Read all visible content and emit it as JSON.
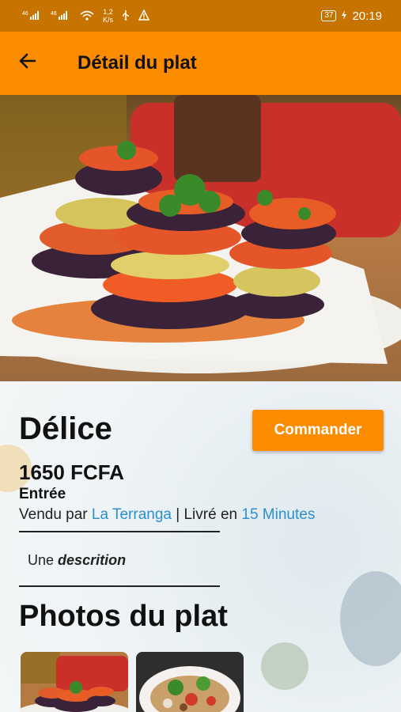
{
  "status_bar": {
    "signal1": "⁴⁶",
    "signal2": "⁴⁶",
    "speed_value": "1,2",
    "speed_unit": "K/s",
    "battery": "37",
    "time": "20:19"
  },
  "app_bar": {
    "title": "Détail du plat"
  },
  "dish": {
    "name": "Délice",
    "order_button": "Commander",
    "price": "1650 FCFA",
    "category": "Entrée",
    "sold_by_prefix": "Vendu par",
    "restaurant": "La Terranga",
    "separator": "|",
    "delivered_prefix": "Livré en",
    "delivery_time": "15 Minutes",
    "description_prefix": "Une",
    "description_word": "descrition"
  },
  "photos": {
    "title": "Photos du plat"
  },
  "colors": {
    "accent": "#fb8c00",
    "status_bar": "#c77300",
    "link": "#2b8fd0"
  }
}
